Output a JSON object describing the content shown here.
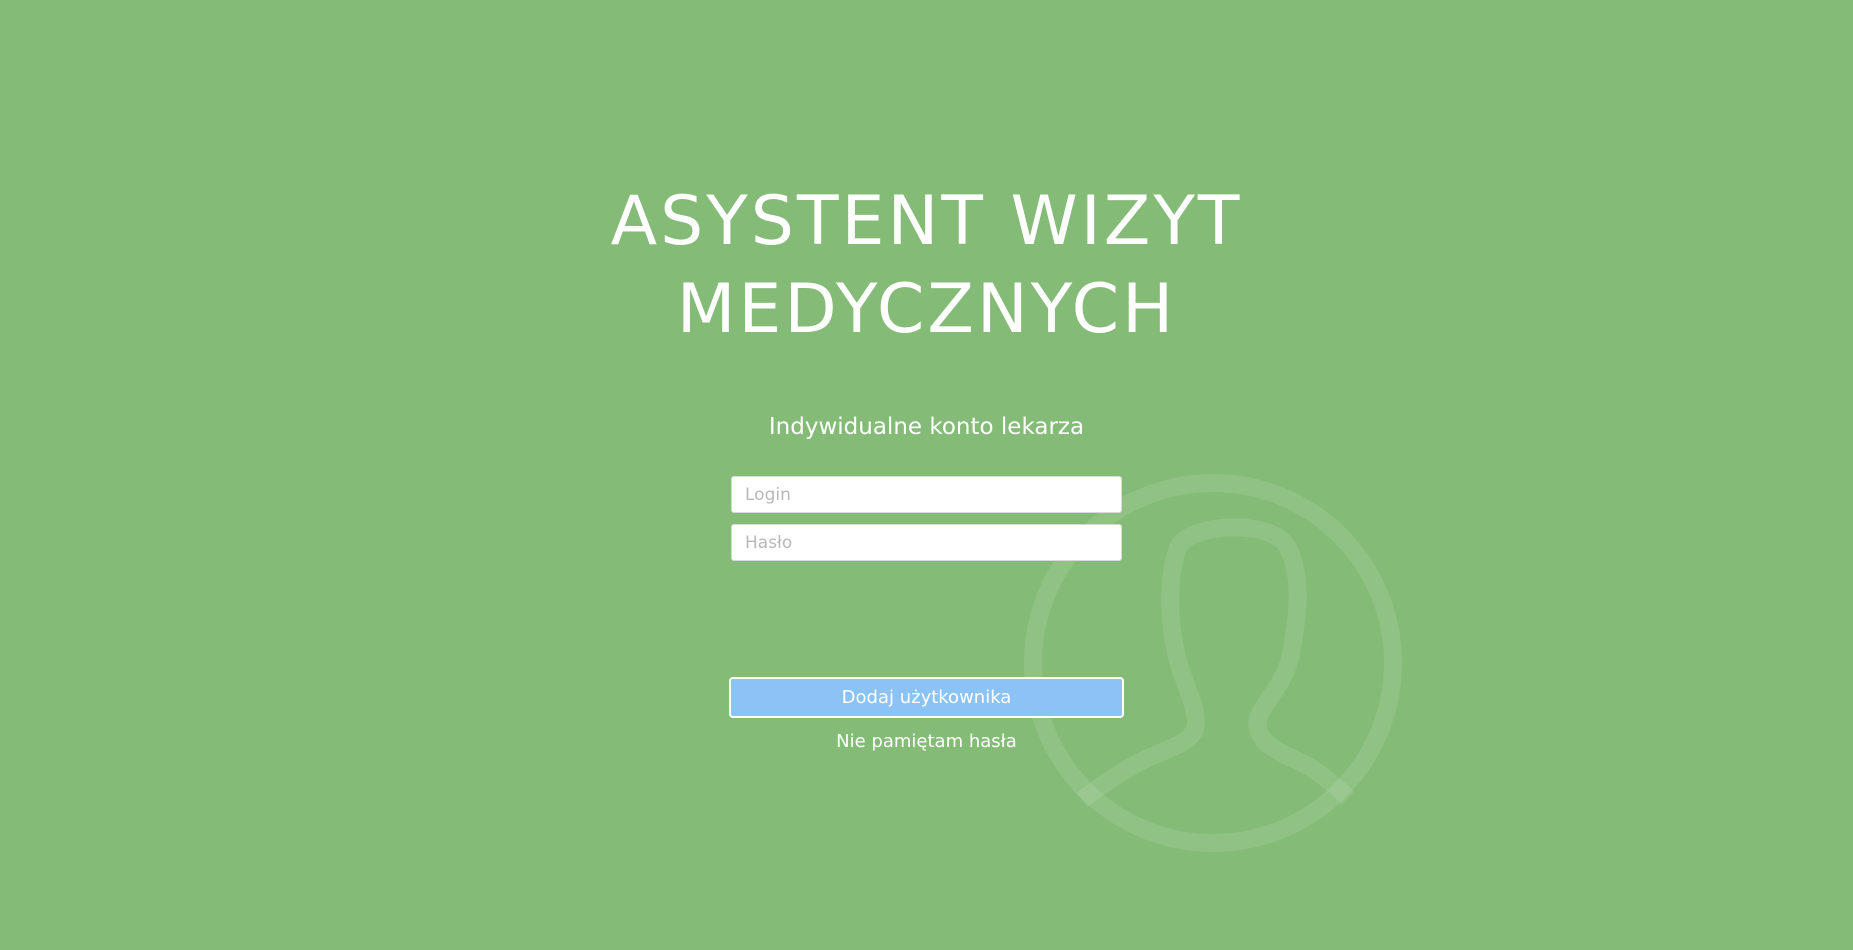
{
  "app": {
    "title_line1": "ASYSTENT WIZYT",
    "title_line2": "MEDYCZNYCH",
    "subtitle": "Indywidualne konto lekarza"
  },
  "form": {
    "login_placeholder": "Login",
    "login_value": "",
    "password_placeholder": "Hasło",
    "password_value": "",
    "submit_label": "Dodaj użytkownika",
    "forgot_label": "Nie pamiętam hasła"
  },
  "decor": {
    "background_icon": "user-avatar-icon"
  },
  "colors": {
    "background": "#84bb77",
    "button": "#8bc3f6",
    "text": "#ffffff"
  }
}
